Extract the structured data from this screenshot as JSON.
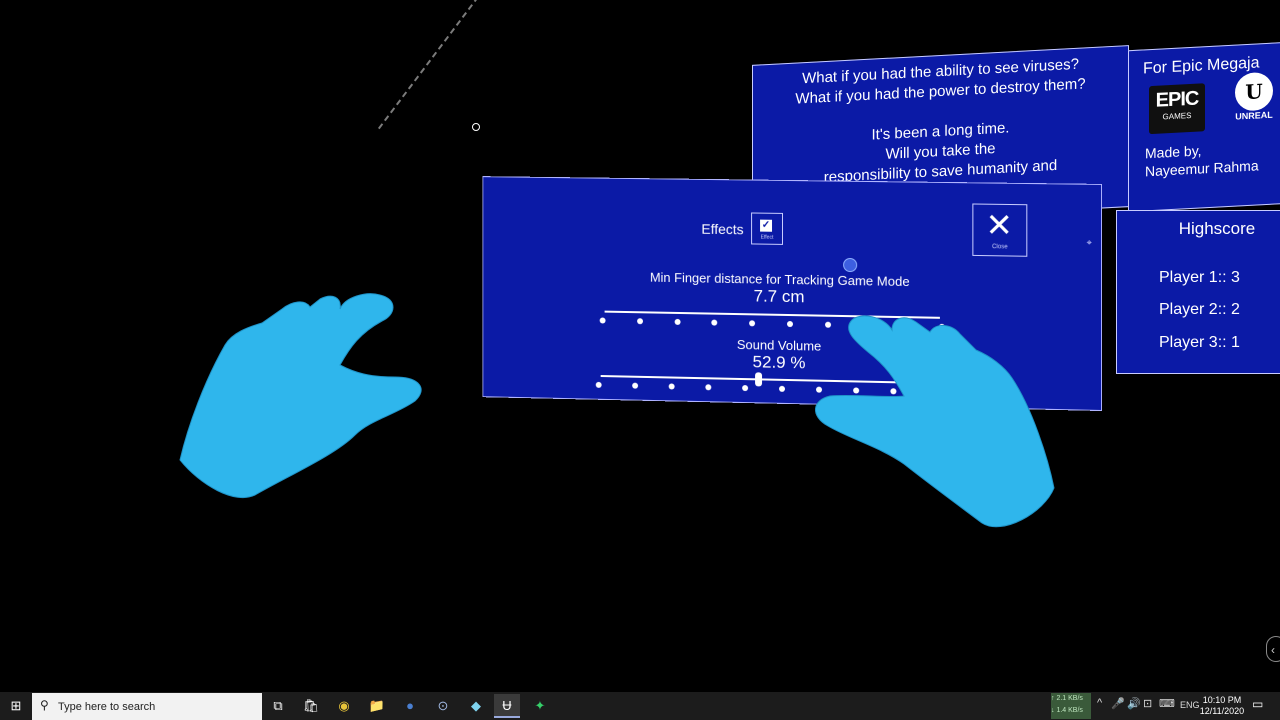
{
  "story": {
    "lines": [
      "What if you had the ability to see viruses?",
      "What if you had the power to destroy them?",
      "",
      "It's been a long time.",
      "Will you take the",
      "responsibility to save humanity and"
    ]
  },
  "credits": {
    "title": "For Epic Megaja",
    "epic_big": "EPIC",
    "epic_small": "GAMES",
    "ue_letter": "U",
    "ue_text": "UNREAL",
    "made_by": "Made by,",
    "author": "Nayeemur Rahma"
  },
  "highscore": {
    "title": "Highscore",
    "players": [
      "Player 1:: 3",
      "Player 2:: 2",
      "Player 3:: 1"
    ]
  },
  "settings": {
    "effects_label": "Effects",
    "effects_checked": true,
    "effects_check_glyph": "✓",
    "effects_tiny": "Effect",
    "close_glyph": "✕",
    "close_label": "Close",
    "side_mark": "⌖",
    "finger_label": "Min Finger distance for Tracking Game Mode",
    "finger_value": "7.7 cm",
    "volume_label": "Sound Volume",
    "volume_value": "52.9 %",
    "volume_fraction": 0.529
  },
  "edge_button": "‹",
  "taskbar": {
    "start_icon": "windows-logo-icon",
    "start_glyph": "⊞",
    "search_glyph": "⚲",
    "search_placeholder": "Type here to search",
    "apps": [
      {
        "name": "task-view-icon",
        "glyph": "⧉"
      },
      {
        "name": "store-icon",
        "glyph": "🛍"
      },
      {
        "name": "chrome-icon",
        "glyph": "◉"
      },
      {
        "name": "file-explorer-icon",
        "glyph": "📁"
      },
      {
        "name": "app-circle-icon",
        "glyph": "●"
      },
      {
        "name": "vr-headset-icon",
        "glyph": "⊙"
      },
      {
        "name": "app-diamond-icon",
        "glyph": "◆"
      },
      {
        "name": "unreal-engine-icon",
        "glyph": "Ʉ"
      },
      {
        "name": "app-green-icon",
        "glyph": "✦"
      }
    ],
    "net_up": "↑ 2.1 KB/s",
    "net_down": "↓ 1.4 KB/s",
    "tray_glyphs": [
      "^",
      "🎤",
      "🔊",
      "⊡",
      "⌨"
    ],
    "language": "ENG",
    "time": "10:10 PM",
    "date": "12/11/2020",
    "notification_glyph": "▭"
  }
}
